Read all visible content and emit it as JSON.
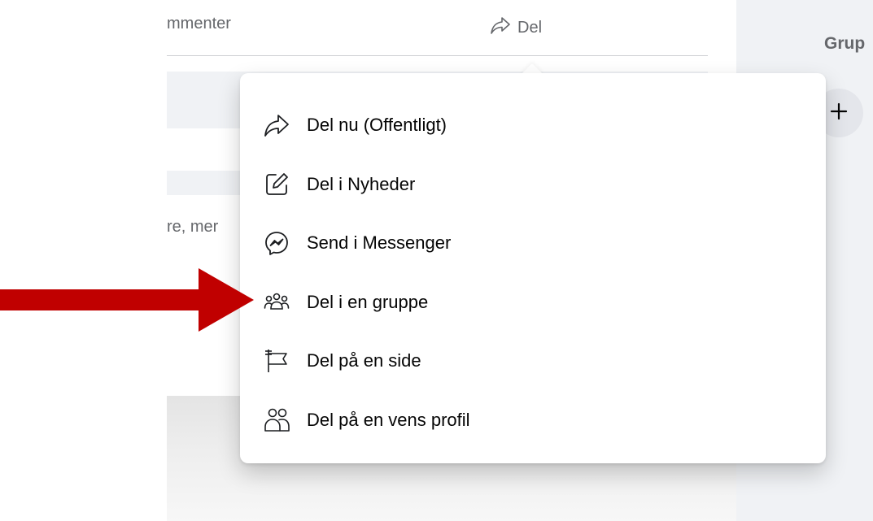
{
  "post_actions": {
    "comment_label_partial": "mmenter",
    "share_label": "Del"
  },
  "comment_preview_partial": "re, mer",
  "sidebar": {
    "heading_partial": "Grup",
    "add_label": "+"
  },
  "share_menu": {
    "items": [
      {
        "label": "Del nu (Offentligt)",
        "icon": "share-arrow-icon"
      },
      {
        "label": "Del i Nyheder",
        "icon": "compose-icon"
      },
      {
        "label": "Send i Messenger",
        "icon": "messenger-icon"
      },
      {
        "label": "Del i en gruppe",
        "icon": "group-icon"
      },
      {
        "label": "Del på en side",
        "icon": "flag-icon"
      },
      {
        "label": "Del på en vens profil",
        "icon": "friends-icon"
      }
    ]
  },
  "annotation": {
    "arrow_color": "#c00000",
    "highlighted_item": "Del i en gruppe"
  }
}
